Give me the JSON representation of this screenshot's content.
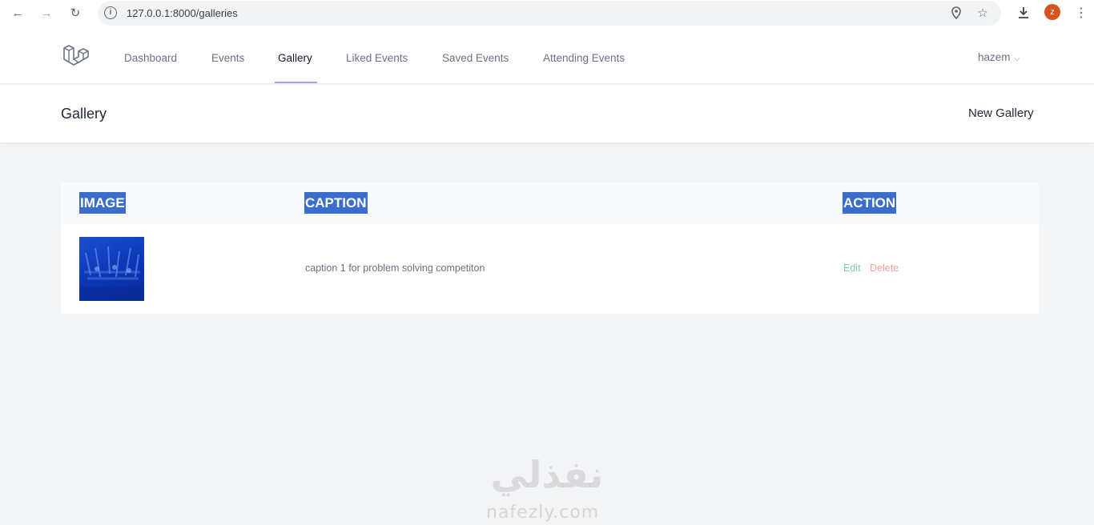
{
  "browser": {
    "url": "127.0.0.1:8000/galleries",
    "profile_initial": "z"
  },
  "nav": {
    "links": [
      {
        "label": "Dashboard"
      },
      {
        "label": "Events"
      },
      {
        "label": "Gallery"
      },
      {
        "label": "Liked Events"
      },
      {
        "label": "Saved Events"
      },
      {
        "label": "Attending Events"
      }
    ],
    "active": "Gallery",
    "user": "hazem"
  },
  "header": {
    "title": "Gallery",
    "new_button": "New Gallery"
  },
  "table": {
    "columns": [
      "IMAGE",
      "CAPTION",
      "ACTION"
    ],
    "rows": [
      {
        "caption": "caption 1 for problem solving competiton",
        "edit": "Edit",
        "delete": "Delete"
      }
    ]
  },
  "watermark": {
    "arabic": "نفذلي",
    "latin": "nafezly.com"
  },
  "colors": {
    "header_highlight": "#3b6dcd",
    "edit": "#7ccf9e",
    "delete": "#f0a09a",
    "active_underline": "#a5a3ea"
  }
}
